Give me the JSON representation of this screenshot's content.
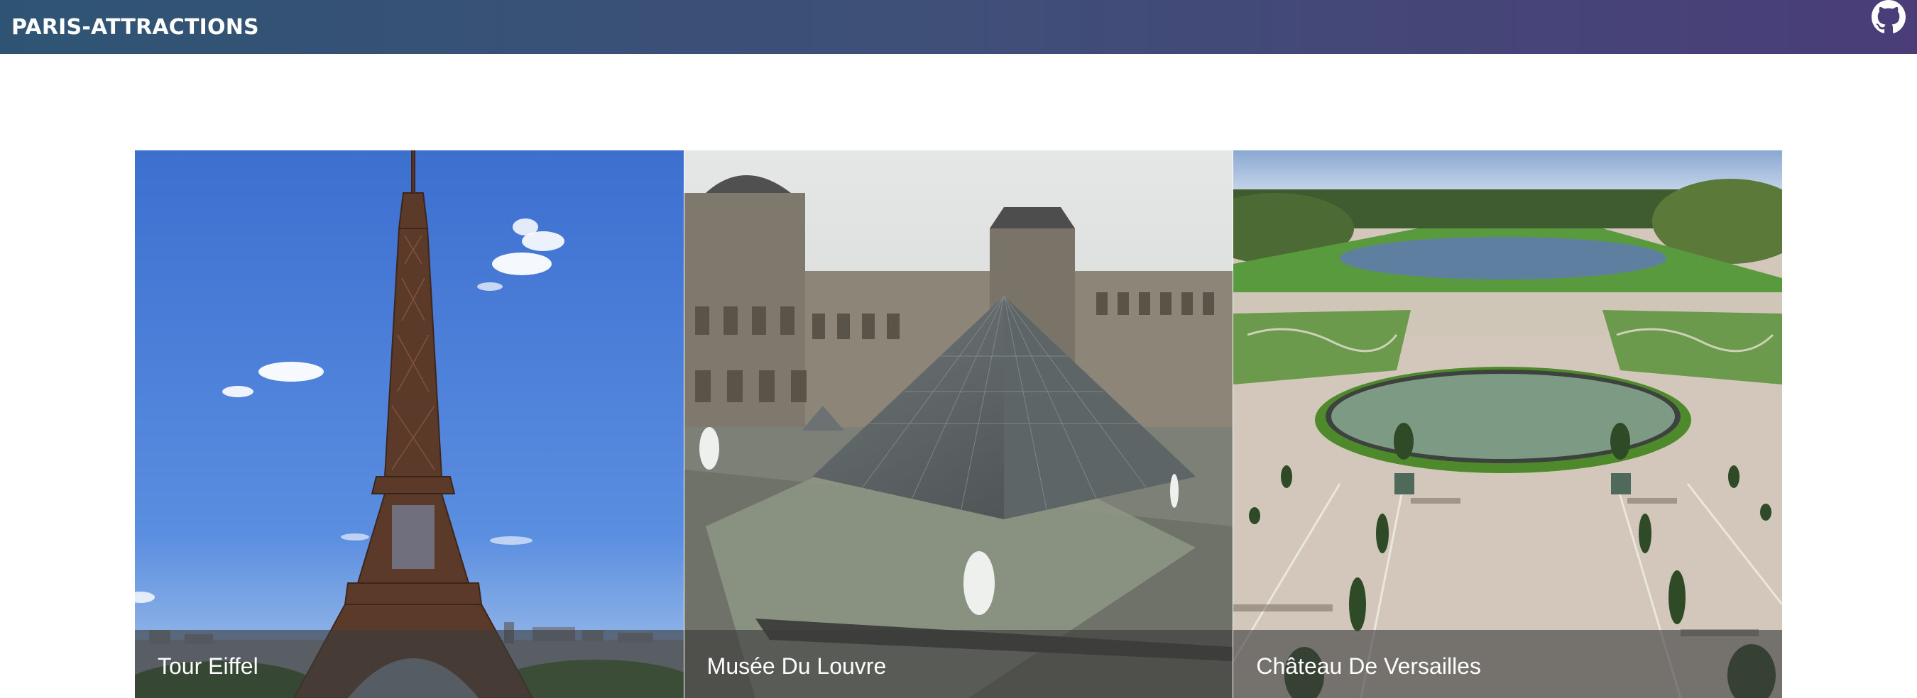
{
  "navbar": {
    "title": "PARIS-ATTRACTIONS",
    "github_icon": "github-icon"
  },
  "attractions": [
    {
      "name": "Tour Eiffel"
    },
    {
      "name": "Musée Du Louvre"
    },
    {
      "name": "Château De Versailles"
    }
  ],
  "colors": {
    "navbar_start": "#2f5473",
    "navbar_end": "#4a3d78",
    "caption_overlay": "rgba(60,60,60,0.62)"
  }
}
